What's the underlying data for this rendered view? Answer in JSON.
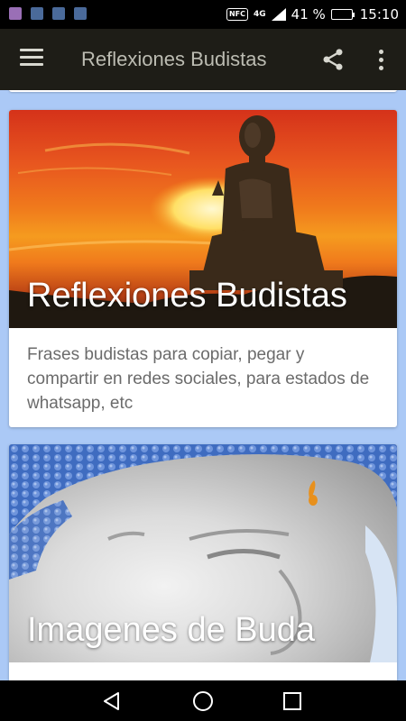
{
  "status_bar": {
    "network": "4G",
    "battery_text": "41 %",
    "battery_level": 0.41,
    "time": "15:10",
    "nfc": "NFC"
  },
  "app_bar": {
    "title": "Reflexiones Budistas",
    "icons": [
      "menu-icon",
      "share-icon",
      "more-vert-icon"
    ]
  },
  "cards": [
    {
      "title": "Reflexiones Budistas",
      "description": "Frases budistas para copiar, pegar y compartir en redes sociales, para estados de whatsapp, etc"
    },
    {
      "title": "Imagenes de Buda",
      "description": ""
    }
  ],
  "colors": {
    "app_bar": "#1e1d17",
    "background": "#abc9f6",
    "title_text": "#bcbcb2"
  },
  "nav_bar": {
    "icons": [
      "back-icon",
      "home-icon",
      "recents-icon"
    ]
  }
}
